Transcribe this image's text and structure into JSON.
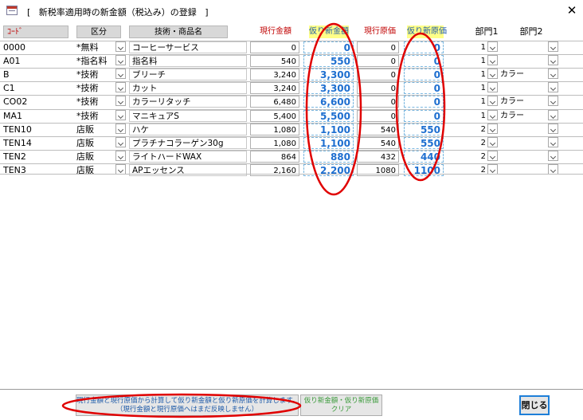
{
  "window": {
    "title": "[   新税率適用時の新金額（税込み）の登録   ]"
  },
  "headers": {
    "code": "ｺｰﾄﾞ",
    "kubun": "区分",
    "name": "技術・商品名",
    "current_price": "現行金額",
    "new_price": "仮り新金額",
    "current_cost": "現行原価",
    "new_cost": "仮り新原価",
    "bumon1": "部門1",
    "bumon2": "部門2"
  },
  "rows": [
    {
      "code": "0000",
      "kubun": "*無料",
      "name": "コーヒーサービス",
      "current_price": "0",
      "new_price": "0",
      "current_cost": "0",
      "new_cost": "0",
      "bumon1": "1",
      "bumon2": ""
    },
    {
      "code": "A01",
      "kubun": "*指名料",
      "name": "指名料",
      "current_price": "540",
      "new_price": "550",
      "current_cost": "0",
      "new_cost": "0",
      "bumon1": "1",
      "bumon2": ""
    },
    {
      "code": "B",
      "kubun": "*技術",
      "name": "ブリーチ",
      "current_price": "3,240",
      "new_price": "3,300",
      "current_cost": "0",
      "new_cost": "0",
      "bumon1": "1",
      "bumon2": "カラー"
    },
    {
      "code": "C1",
      "kubun": "*技術",
      "name": "カット",
      "current_price": "3,240",
      "new_price": "3,300",
      "current_cost": "0",
      "new_cost": "0",
      "bumon1": "1",
      "bumon2": ""
    },
    {
      "code": "CO02",
      "kubun": "*技術",
      "name": "カラーリタッチ",
      "current_price": "6,480",
      "new_price": "6,600",
      "current_cost": "0",
      "new_cost": "0",
      "bumon1": "1",
      "bumon2": "カラー"
    },
    {
      "code": "MA1",
      "kubun": "*技術",
      "name": "マニキュアS",
      "current_price": "5,400",
      "new_price": "5,500",
      "current_cost": "0",
      "new_cost": "0",
      "bumon1": "1",
      "bumon2": "カラー"
    },
    {
      "code": "TEN10",
      "kubun": "店販",
      "name": "ハケ",
      "current_price": "1,080",
      "new_price": "1,100",
      "current_cost": "540",
      "new_cost": "550",
      "bumon1": "2",
      "bumon2": ""
    },
    {
      "code": "TEN14",
      "kubun": "店販",
      "name": "プラチナコラーゲン30g",
      "current_price": "1,080",
      "new_price": "1,100",
      "current_cost": "540",
      "new_cost": "550",
      "bumon1": "2",
      "bumon2": ""
    },
    {
      "code": "TEN2",
      "kubun": "店販",
      "name": "ライトハードWAX",
      "current_price": "864",
      "new_price": "880",
      "current_cost": "432",
      "new_cost": "440",
      "bumon1": "2",
      "bumon2": ""
    },
    {
      "code": "TEN3",
      "kubun": "店販",
      "name": "APエッセンス",
      "current_price": "2,160",
      "new_price": "2,200",
      "current_cost": "1080",
      "new_cost": "1100",
      "bumon1": "2",
      "bumon2": ""
    }
  ],
  "buttons": {
    "calc_line1": "現行金額と現行原価から計算して仮り新金額と仮り新原価を計算します。",
    "calc_line2": "（現行金額と現行原価へはまだ反映しません）",
    "clear_line1": "仮り新金額・仮り新原価",
    "clear_line2": "クリア",
    "close": "閉じる"
  },
  "colors": {
    "annotation": "#e00000",
    "new_value_text": "#1e6fd0",
    "header_highlight": "#ffff88",
    "close_border": "#1e7fd8"
  }
}
